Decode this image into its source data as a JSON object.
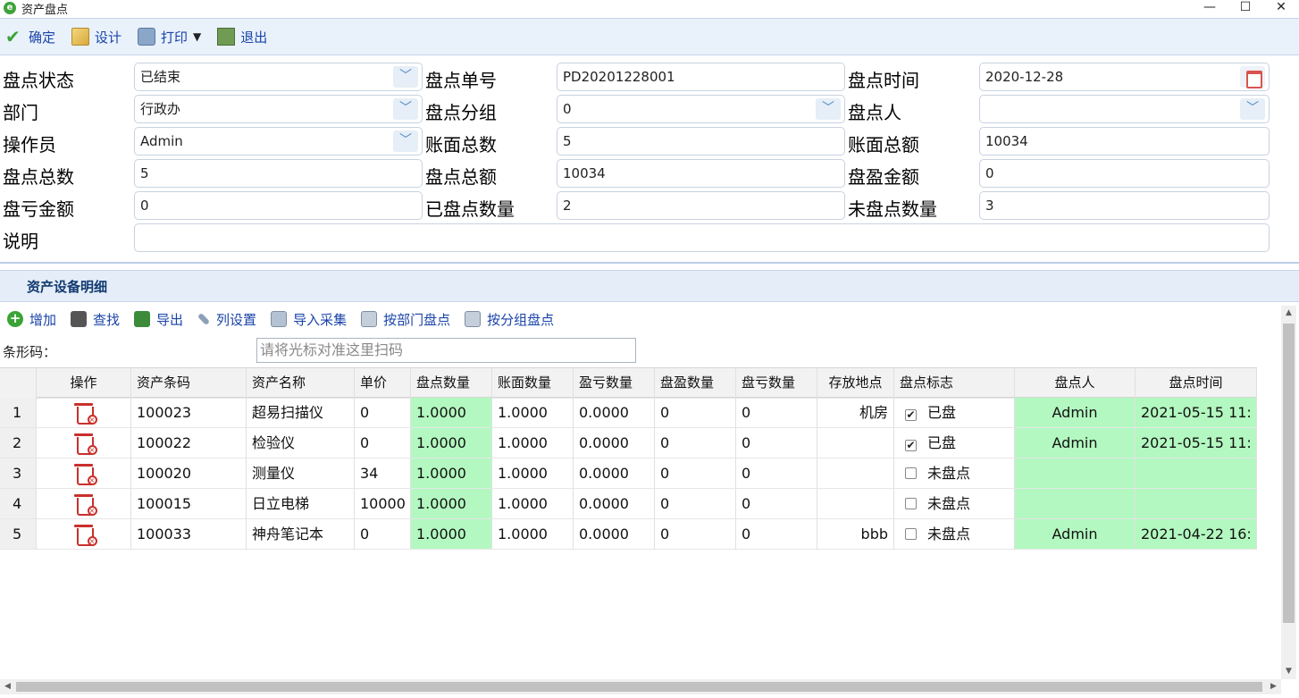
{
  "window": {
    "title": "资产盘点"
  },
  "toolbar": {
    "confirm": "确定",
    "design": "设计",
    "print": "打印",
    "exit": "退出"
  },
  "form": {
    "status_label": "盘点状态",
    "status_value": "已结束",
    "order_no_label": "盘点单号",
    "order_no_value": "PD20201228001",
    "time_label": "盘点时间",
    "time_value": "2020-12-28",
    "dept_label": "部门",
    "dept_value": "行政办",
    "group_label": "盘点分组",
    "group_value": "0",
    "checker_label": "盘点人",
    "checker_value": "",
    "operator_label": "操作员",
    "operator_value": "Admin",
    "book_total_label": "账面总数",
    "book_total_value": "5",
    "book_amount_label": "账面总额",
    "book_amount_value": "10034",
    "count_total_label": "盘点总数",
    "count_total_value": "5",
    "count_amount_label": "盘点总额",
    "count_amount_value": "10034",
    "surplus_amount_label": "盘盈金额",
    "surplus_amount_value": "0",
    "loss_amount_label": "盘亏金额",
    "loss_amount_value": "0",
    "counted_qty_label": "已盘点数量",
    "counted_qty_value": "2",
    "uncounted_qty_label": "未盘点数量",
    "uncounted_qty_value": "3",
    "note_label": "说明",
    "note_value": ""
  },
  "detail": {
    "section_title": "资产设备明细",
    "toolbar": {
      "add": "增加",
      "find": "查找",
      "export": "导出",
      "columns": "列设置",
      "import": "导入采集",
      "by_dept": "按部门盘点",
      "by_group": "按分组盘点"
    },
    "barcode_label": "条形码：",
    "barcode_placeholder": "请将光标对准这里扫码",
    "columns": [
      "操作",
      "资产条码",
      "资产名称",
      "单价",
      "盘点数量",
      "账面数量",
      "盈亏数量",
      "盘盈数量",
      "盘亏数量",
      "存放地点",
      "盘点标志",
      "盘点人",
      "盘点时间"
    ],
    "rows": [
      {
        "no": "1",
        "code": "100023",
        "name": "超易扫描仪",
        "price": "0",
        "count_qty": "1.0000",
        "book_qty": "1.0000",
        "diff_qty": "0.0000",
        "surplus_qty": "0",
        "loss_qty": "0",
        "location": "机房",
        "checked": true,
        "flag": "已盘",
        "checker": "Admin",
        "time": "2021-05-15 11:"
      },
      {
        "no": "2",
        "code": "100022",
        "name": "检验仪",
        "price": "0",
        "count_qty": "1.0000",
        "book_qty": "1.0000",
        "diff_qty": "0.0000",
        "surplus_qty": "0",
        "loss_qty": "0",
        "location": "",
        "checked": true,
        "flag": "已盘",
        "checker": "Admin",
        "time": "2021-05-15 11:"
      },
      {
        "no": "3",
        "code": "100020",
        "name": "测量仪",
        "price": "34",
        "count_qty": "1.0000",
        "book_qty": "1.0000",
        "diff_qty": "0.0000",
        "surplus_qty": "0",
        "loss_qty": "0",
        "location": "",
        "checked": false,
        "flag": "未盘点",
        "checker": "",
        "time": ""
      },
      {
        "no": "4",
        "code": "100015",
        "name": "日立电梯",
        "price": "10000",
        "count_qty": "1.0000",
        "book_qty": "1.0000",
        "diff_qty": "0.0000",
        "surplus_qty": "0",
        "loss_qty": "0",
        "location": "",
        "checked": false,
        "flag": "未盘点",
        "checker": "",
        "time": ""
      },
      {
        "no": "5",
        "code": "100033",
        "name": "神舟笔记本",
        "price": "0",
        "count_qty": "1.0000",
        "book_qty": "1.0000",
        "diff_qty": "0.0000",
        "surplus_qty": "0",
        "loss_qty": "0",
        "location": "bbb",
        "checked": false,
        "flag": "未盘点",
        "checker": "Admin",
        "time": "2021-04-22 16:"
      }
    ]
  },
  "colors": {
    "toolbar_bg": "#e9f1fb",
    "link_text": "#1a44a8",
    "highlight_green": "#b3f8c0",
    "delete_red": "#c9302c"
  }
}
